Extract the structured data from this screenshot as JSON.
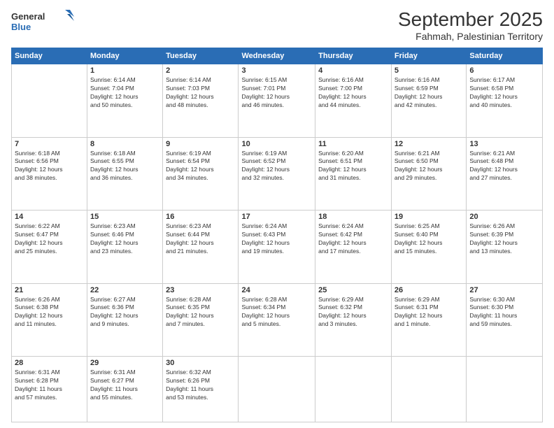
{
  "logo": {
    "general": "General",
    "blue": "Blue"
  },
  "header": {
    "month": "September 2025",
    "location": "Fahmah, Palestinian Territory"
  },
  "days_of_week": [
    "Sunday",
    "Monday",
    "Tuesday",
    "Wednesday",
    "Thursday",
    "Friday",
    "Saturday"
  ],
  "weeks": [
    [
      {
        "day": null,
        "info": null
      },
      {
        "day": "1",
        "info": "Sunrise: 6:14 AM\nSunset: 7:04 PM\nDaylight: 12 hours\nand 50 minutes."
      },
      {
        "day": "2",
        "info": "Sunrise: 6:14 AM\nSunset: 7:03 PM\nDaylight: 12 hours\nand 48 minutes."
      },
      {
        "day": "3",
        "info": "Sunrise: 6:15 AM\nSunset: 7:01 PM\nDaylight: 12 hours\nand 46 minutes."
      },
      {
        "day": "4",
        "info": "Sunrise: 6:16 AM\nSunset: 7:00 PM\nDaylight: 12 hours\nand 44 minutes."
      },
      {
        "day": "5",
        "info": "Sunrise: 6:16 AM\nSunset: 6:59 PM\nDaylight: 12 hours\nand 42 minutes."
      },
      {
        "day": "6",
        "info": "Sunrise: 6:17 AM\nSunset: 6:58 PM\nDaylight: 12 hours\nand 40 minutes."
      }
    ],
    [
      {
        "day": "7",
        "info": "Sunrise: 6:18 AM\nSunset: 6:56 PM\nDaylight: 12 hours\nand 38 minutes."
      },
      {
        "day": "8",
        "info": "Sunrise: 6:18 AM\nSunset: 6:55 PM\nDaylight: 12 hours\nand 36 minutes."
      },
      {
        "day": "9",
        "info": "Sunrise: 6:19 AM\nSunset: 6:54 PM\nDaylight: 12 hours\nand 34 minutes."
      },
      {
        "day": "10",
        "info": "Sunrise: 6:19 AM\nSunset: 6:52 PM\nDaylight: 12 hours\nand 32 minutes."
      },
      {
        "day": "11",
        "info": "Sunrise: 6:20 AM\nSunset: 6:51 PM\nDaylight: 12 hours\nand 31 minutes."
      },
      {
        "day": "12",
        "info": "Sunrise: 6:21 AM\nSunset: 6:50 PM\nDaylight: 12 hours\nand 29 minutes."
      },
      {
        "day": "13",
        "info": "Sunrise: 6:21 AM\nSunset: 6:48 PM\nDaylight: 12 hours\nand 27 minutes."
      }
    ],
    [
      {
        "day": "14",
        "info": "Sunrise: 6:22 AM\nSunset: 6:47 PM\nDaylight: 12 hours\nand 25 minutes."
      },
      {
        "day": "15",
        "info": "Sunrise: 6:23 AM\nSunset: 6:46 PM\nDaylight: 12 hours\nand 23 minutes."
      },
      {
        "day": "16",
        "info": "Sunrise: 6:23 AM\nSunset: 6:44 PM\nDaylight: 12 hours\nand 21 minutes."
      },
      {
        "day": "17",
        "info": "Sunrise: 6:24 AM\nSunset: 6:43 PM\nDaylight: 12 hours\nand 19 minutes."
      },
      {
        "day": "18",
        "info": "Sunrise: 6:24 AM\nSunset: 6:42 PM\nDaylight: 12 hours\nand 17 minutes."
      },
      {
        "day": "19",
        "info": "Sunrise: 6:25 AM\nSunset: 6:40 PM\nDaylight: 12 hours\nand 15 minutes."
      },
      {
        "day": "20",
        "info": "Sunrise: 6:26 AM\nSunset: 6:39 PM\nDaylight: 12 hours\nand 13 minutes."
      }
    ],
    [
      {
        "day": "21",
        "info": "Sunrise: 6:26 AM\nSunset: 6:38 PM\nDaylight: 12 hours\nand 11 minutes."
      },
      {
        "day": "22",
        "info": "Sunrise: 6:27 AM\nSunset: 6:36 PM\nDaylight: 12 hours\nand 9 minutes."
      },
      {
        "day": "23",
        "info": "Sunrise: 6:28 AM\nSunset: 6:35 PM\nDaylight: 12 hours\nand 7 minutes."
      },
      {
        "day": "24",
        "info": "Sunrise: 6:28 AM\nSunset: 6:34 PM\nDaylight: 12 hours\nand 5 minutes."
      },
      {
        "day": "25",
        "info": "Sunrise: 6:29 AM\nSunset: 6:32 PM\nDaylight: 12 hours\nand 3 minutes."
      },
      {
        "day": "26",
        "info": "Sunrise: 6:29 AM\nSunset: 6:31 PM\nDaylight: 12 hours\nand 1 minute."
      },
      {
        "day": "27",
        "info": "Sunrise: 6:30 AM\nSunset: 6:30 PM\nDaylight: 11 hours\nand 59 minutes."
      }
    ],
    [
      {
        "day": "28",
        "info": "Sunrise: 6:31 AM\nSunset: 6:28 PM\nDaylight: 11 hours\nand 57 minutes."
      },
      {
        "day": "29",
        "info": "Sunrise: 6:31 AM\nSunset: 6:27 PM\nDaylight: 11 hours\nand 55 minutes."
      },
      {
        "day": "30",
        "info": "Sunrise: 6:32 AM\nSunset: 6:26 PM\nDaylight: 11 hours\nand 53 minutes."
      },
      {
        "day": null,
        "info": null
      },
      {
        "day": null,
        "info": null
      },
      {
        "day": null,
        "info": null
      },
      {
        "day": null,
        "info": null
      }
    ]
  ]
}
